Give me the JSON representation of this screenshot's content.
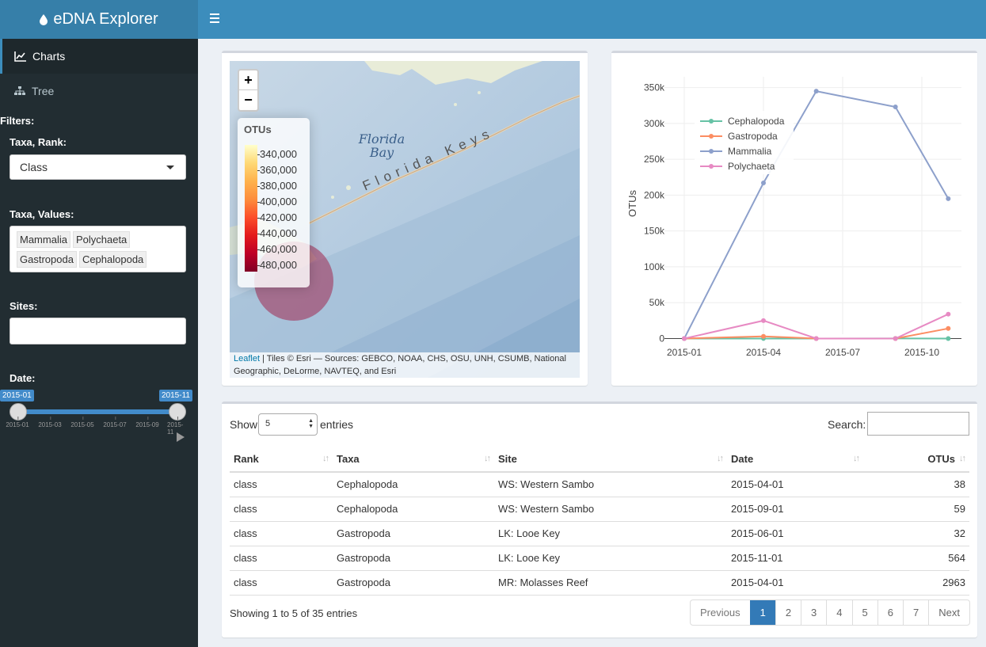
{
  "app": {
    "title": "eDNA Explorer"
  },
  "sidebar": {
    "menu": [
      {
        "label": "Charts",
        "icon": "line-chart-icon",
        "active": true
      },
      {
        "label": "Tree",
        "icon": "sitemap-icon",
        "active": false
      }
    ],
    "filters_title": "Filters:",
    "taxa_rank": {
      "label": "Taxa, Rank:",
      "value": "Class"
    },
    "taxa_values": {
      "label": "Taxa, Values:",
      "tags": [
        "Mammalia",
        "Polychaeta",
        "Gastropoda",
        "Cephalopoda"
      ]
    },
    "sites": {
      "label": "Sites:",
      "value": ""
    },
    "date": {
      "label": "Date:",
      "from": "2015-01",
      "to": "2015-11",
      "ticks": [
        "2015-01",
        "2015-03",
        "2015-05",
        "2015-07",
        "2015-09",
        "2015-11"
      ]
    }
  },
  "map": {
    "zoom_in": "+",
    "zoom_out": "−",
    "legend_title": "OTUs",
    "legend_labels": [
      "340,000",
      "360,000",
      "380,000",
      "400,000",
      "420,000",
      "440,000",
      "460,000",
      "480,000"
    ],
    "place_bay": [
      "Florida",
      "Bay"
    ],
    "place_keys": "Florida Keys",
    "attribution_link": "Leaflet",
    "attribution_text": " | Tiles © Esri — Sources: GEBCO, NOAA, CHS, OSU, UNH, CSUMB, National Geographic, DeLorme, NAVTEQ, and Esri"
  },
  "chart_data": {
    "type": "line",
    "x": [
      "2015-01",
      "2015-04",
      "2015-06",
      "2015-09",
      "2015-11"
    ],
    "x_ticks": [
      "2015-01",
      "2015-04",
      "2015-07",
      "2015-10"
    ],
    "ylabel": "OTUs",
    "y_ticks": [
      0,
      50000,
      100000,
      150000,
      200000,
      250000,
      300000,
      350000
    ],
    "y_tick_labels": [
      "0",
      "50k",
      "100k",
      "150k",
      "200k",
      "250k",
      "300k",
      "350k"
    ],
    "ylim": [
      -5000,
      365000
    ],
    "legend_position": "top-left",
    "series": [
      {
        "name": "Cephalopoda",
        "color": "#66c2a5",
        "values": [
          0,
          38,
          0,
          59,
          0
        ]
      },
      {
        "name": "Gastropoda",
        "color": "#fc8d62",
        "values": [
          0,
          2963,
          32,
          0,
          14000
        ]
      },
      {
        "name": "Mammalia",
        "color": "#8da0cb",
        "values": [
          0,
          217000,
          345000,
          323000,
          195000
        ]
      },
      {
        "name": "Polychaeta",
        "color": "#e78ac3",
        "values": [
          0,
          25000,
          0,
          0,
          34000
        ]
      }
    ]
  },
  "table": {
    "show_label": "Show",
    "entries_label": "entries",
    "page_length": "5",
    "search_label": "Search:",
    "search_value": "",
    "columns": [
      "Rank",
      "Taxa",
      "Site",
      "Date",
      "OTUs"
    ],
    "rows": [
      [
        "class",
        "Cephalopoda",
        "WS: Western Sambo",
        "2015-04-01",
        "38"
      ],
      [
        "class",
        "Cephalopoda",
        "WS: Western Sambo",
        "2015-09-01",
        "59"
      ],
      [
        "class",
        "Gastropoda",
        "LK: Looe Key",
        "2015-06-01",
        "32"
      ],
      [
        "class",
        "Gastropoda",
        "LK: Looe Key",
        "2015-11-01",
        "564"
      ],
      [
        "class",
        "Gastropoda",
        "MR: Molasses Reef",
        "2015-04-01",
        "2963"
      ]
    ],
    "info": "Showing 1 to 5 of 35 entries",
    "pager": [
      "Previous",
      "1",
      "2",
      "3",
      "4",
      "5",
      "6",
      "7",
      "Next"
    ],
    "active_page": "1"
  }
}
